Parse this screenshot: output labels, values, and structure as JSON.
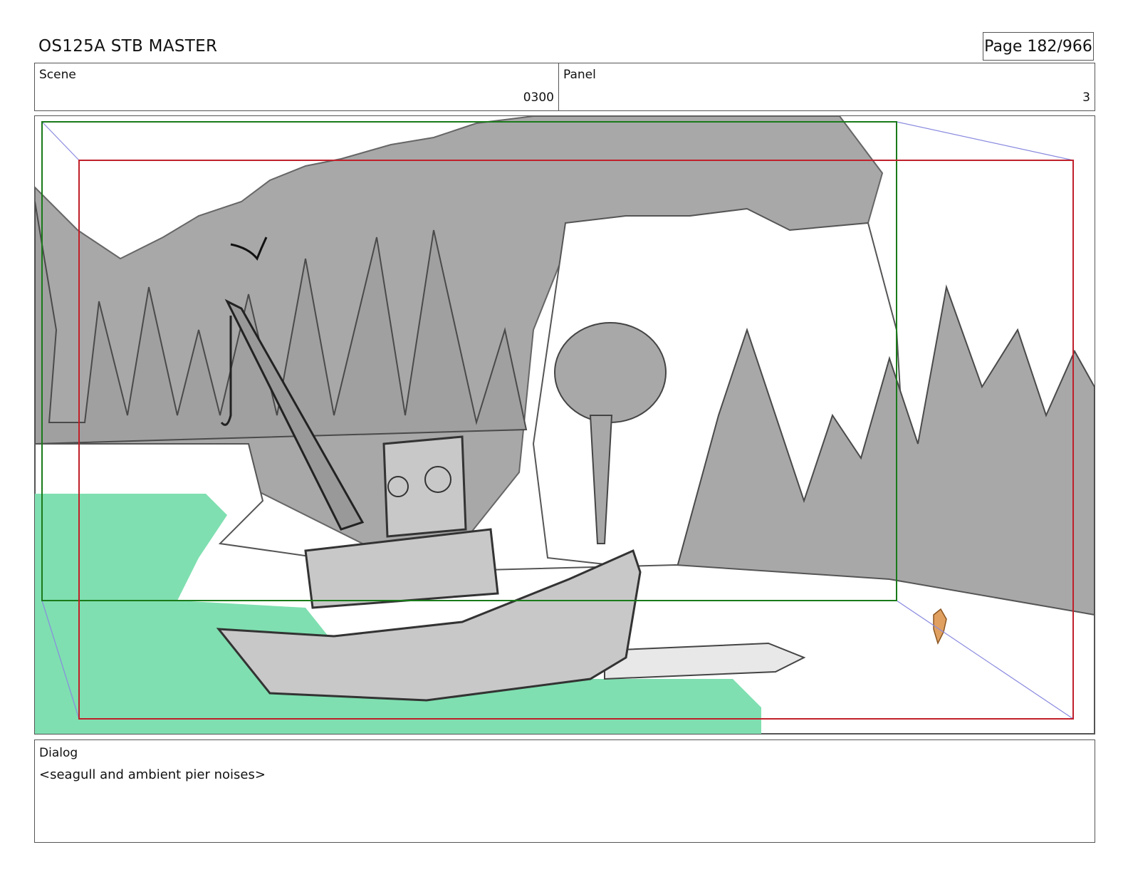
{
  "header": {
    "title": "OS125A  STB MASTER",
    "page": "Page 182/966"
  },
  "scene": {
    "label": "Scene",
    "value": "0300"
  },
  "panel": {
    "label": "Panel",
    "value": "3"
  },
  "dialog": {
    "label": "Dialog",
    "text": "<seagull and ambient pier noises>"
  },
  "colors": {
    "water": "#7fdfb0",
    "safe_frame_green": "#1a7a1a",
    "camera_frame_red": "#c0202a",
    "camera_path_blue": "#8a8ae0",
    "rock_gray": "#a8a8a8",
    "boat_gray": "#c8c8c8",
    "character_orange": "#e0a060"
  }
}
